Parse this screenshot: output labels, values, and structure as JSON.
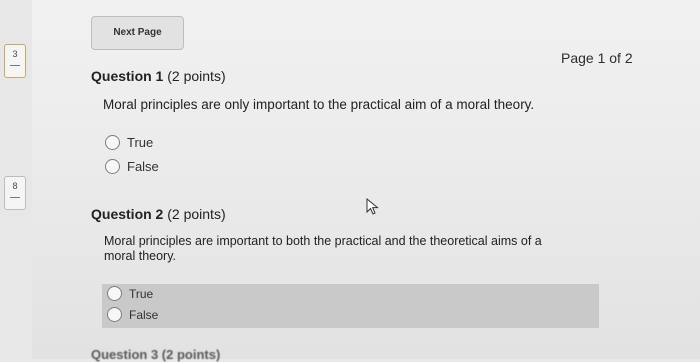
{
  "nav": {
    "items": [
      {
        "label": "3"
      },
      {
        "label": "8"
      }
    ],
    "next_page_label": "Next Page"
  },
  "page_indicator": "Page 1 of 2",
  "questions": [
    {
      "title": "Question 1",
      "points": "(2 points)",
      "text": "Moral principles are only important to the practical aim of a moral theory.",
      "options": [
        "True",
        "False"
      ]
    },
    {
      "title": "Question 2",
      "points": "(2 points)",
      "text_line1": "Moral principles are important to both the practical and the theoretical aims of a",
      "text_line2": "moral theory.",
      "options": [
        "True",
        "False"
      ]
    }
  ],
  "next_question_peek": "Question 3 (2 points)",
  "icons": {
    "cursor": "mouse-pointer-icon",
    "radio": "radio-unselected-icon"
  }
}
